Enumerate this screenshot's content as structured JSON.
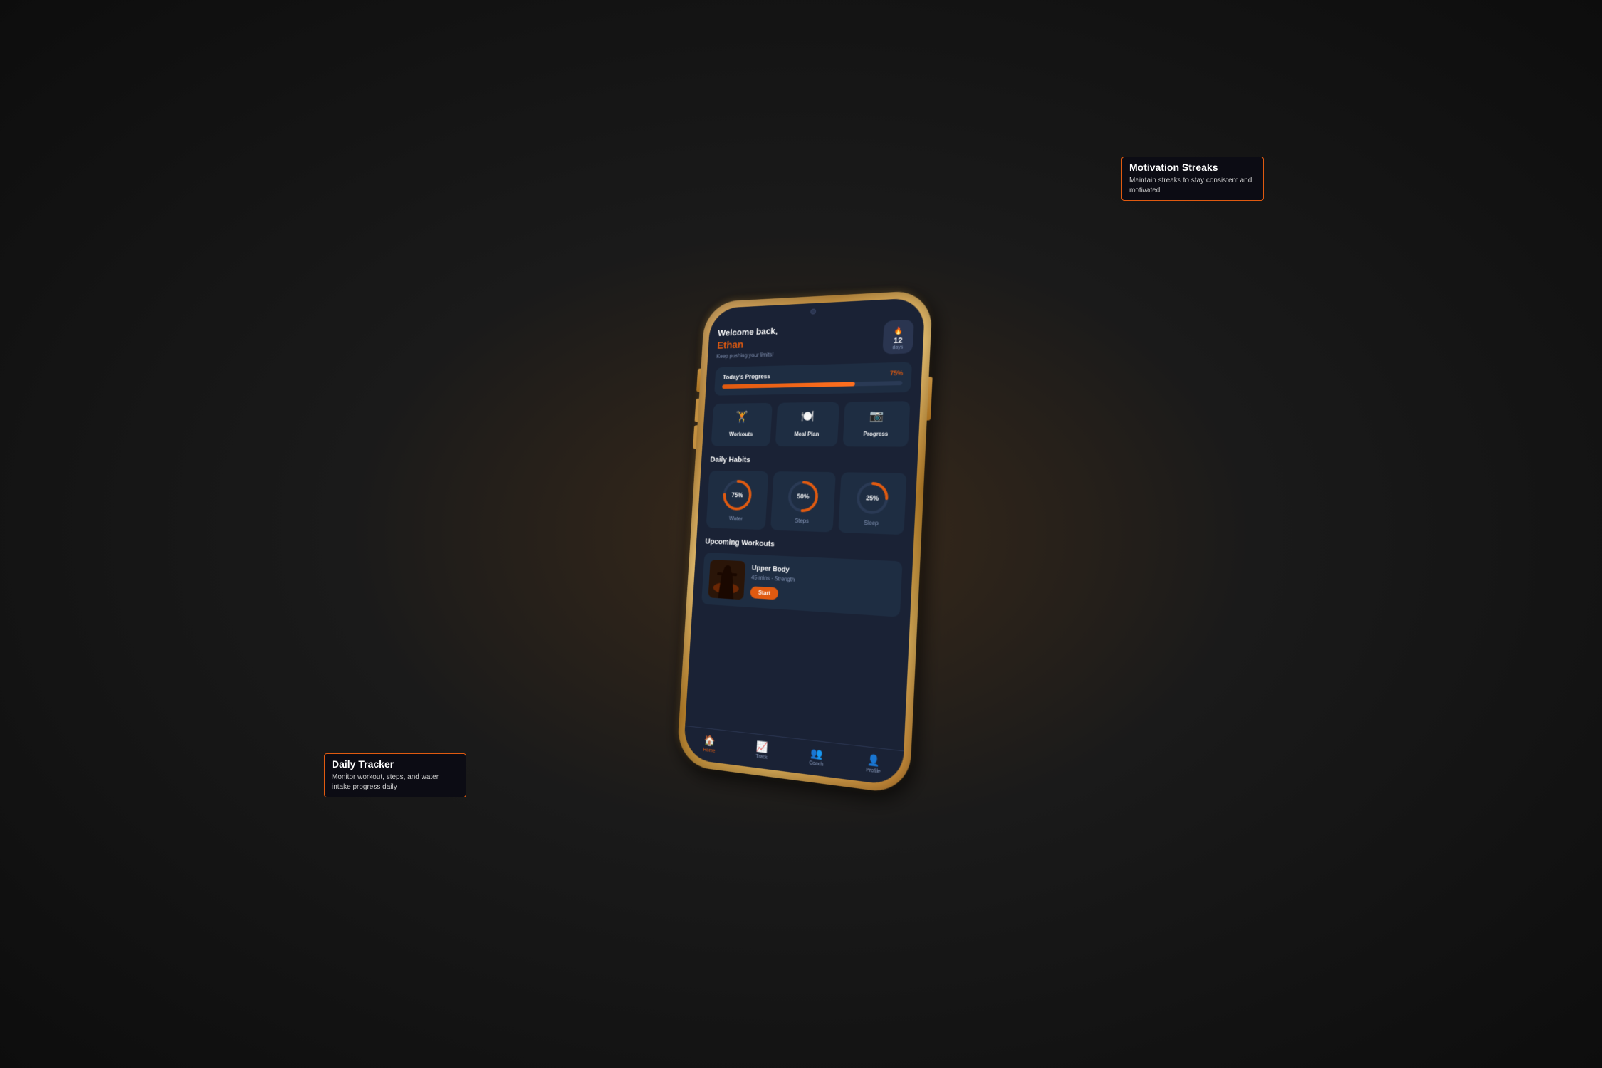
{
  "background": "#1a1a1a",
  "accent_color": "#e05a10",
  "app": {
    "header": {
      "welcome_line1": "Welcome back,",
      "welcome_name": "Ethan",
      "subtitle": "Keep pushing your limits!",
      "streak_num": "12",
      "streak_label": "days"
    },
    "progress": {
      "label": "Today's Progress",
      "percentage": "75%",
      "fill_width": "75%"
    },
    "quick_actions": [
      {
        "icon": "🏋️",
        "label": "Workouts"
      },
      {
        "icon": "🍽️",
        "label": "Meal Plan"
      },
      {
        "icon": "📷",
        "label": "Progress"
      }
    ],
    "daily_habits": {
      "title": "Daily Habits",
      "items": [
        {
          "name": "Water",
          "percentage": 75,
          "circumference": 126
        },
        {
          "name": "Steps",
          "percentage": 50,
          "circumference": 126
        },
        {
          "name": "Sleep",
          "percentage": 25,
          "circumference": 126
        }
      ]
    },
    "upcoming_workouts": {
      "title": "Upcoming Workouts",
      "items": [
        {
          "title": "Upper Body",
          "meta": "45 mins · Strength",
          "start_label": "Start"
        }
      ]
    },
    "bottom_nav": [
      {
        "icon": "🏠",
        "label": "Home",
        "active": true
      },
      {
        "icon": "📈",
        "label": "Track",
        "active": false
      },
      {
        "icon": "👥",
        "label": "Coach",
        "active": false
      },
      {
        "icon": "👤",
        "label": "Profile",
        "active": false
      }
    ]
  },
  "annotations": {
    "streaks": {
      "title": "Motivation Streaks",
      "text": "Maintain streaks to stay consistent and motivated"
    },
    "tracker": {
      "title": "Daily Tracker",
      "text": "Monitor workout, steps, and water intake progress daily"
    }
  }
}
